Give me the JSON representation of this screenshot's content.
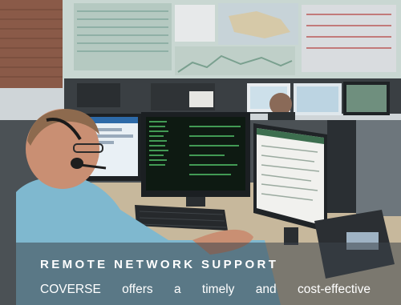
{
  "banner": {
    "heading": "REMOTE NETWORK SUPPORT",
    "description": "COVERSE offers a timely and cost-effective"
  },
  "photo": {
    "subject": "network operations center technician with headset at multi-monitor desk"
  },
  "colors": {
    "caption_overlay": "#3c444a",
    "caption_text": "#ffffff",
    "wall_panel": "#b5c9c1",
    "shirt": "#7fb8cf",
    "brick": "#8a5a48"
  }
}
